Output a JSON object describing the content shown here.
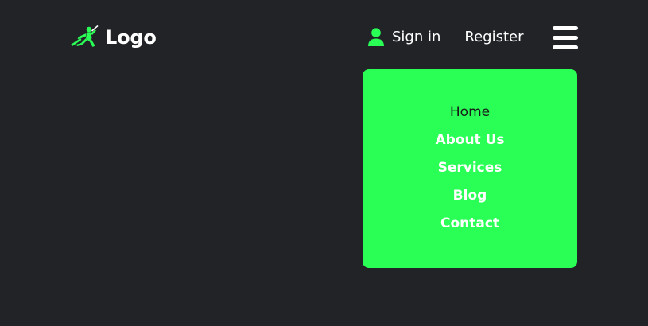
{
  "colors": {
    "background": "#222327",
    "accent": "#29ff55",
    "text": "#ffffff",
    "active_text": "#1a1a1a"
  },
  "header": {
    "brand": {
      "icon": "runner-figure-icon",
      "text": "Logo"
    },
    "sign_in": {
      "icon": "user-icon",
      "label": "Sign in"
    },
    "register": {
      "label": "Register"
    },
    "menu_toggle": {
      "icon": "hamburger-menu-icon"
    }
  },
  "dropdown": {
    "items": [
      {
        "label": "Home",
        "active": true
      },
      {
        "label": "About Us",
        "active": false
      },
      {
        "label": "Services",
        "active": false
      },
      {
        "label": "Blog",
        "active": false
      },
      {
        "label": "Contact",
        "active": false
      }
    ]
  }
}
